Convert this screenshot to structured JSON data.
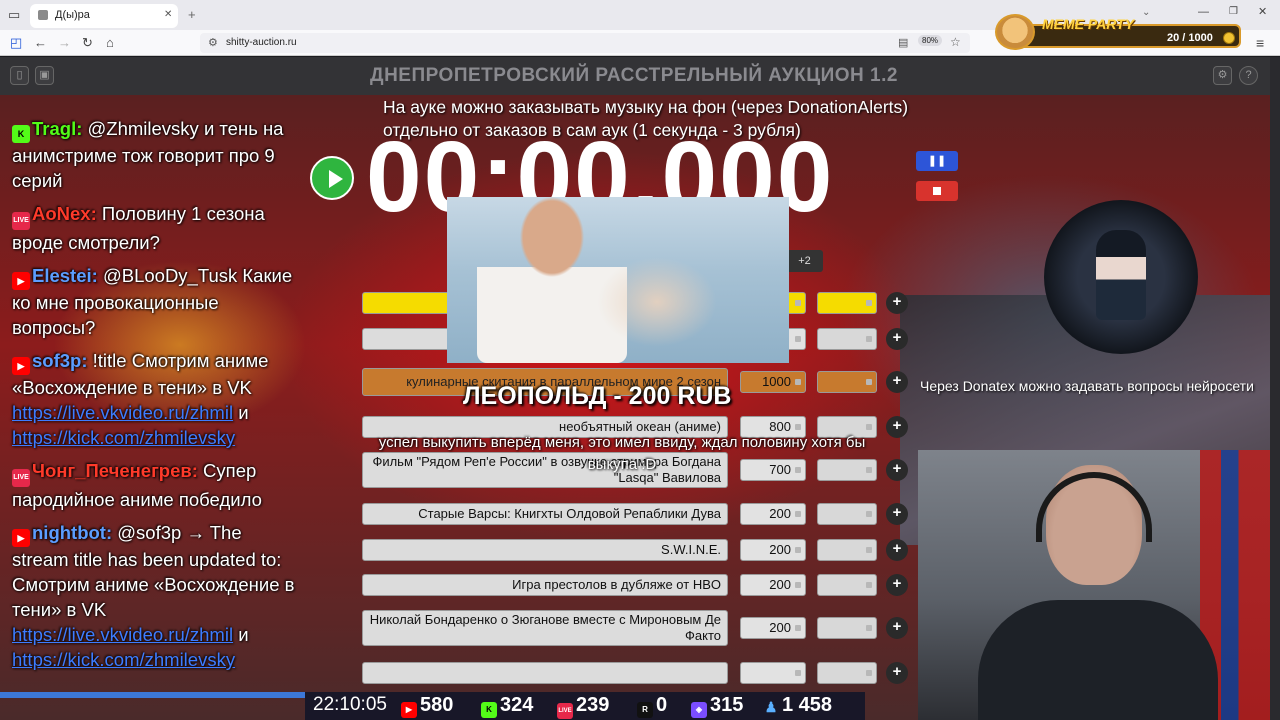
{
  "browser": {
    "tab_title": "Д(ы)ра",
    "url": "shitty-auction.ru",
    "zoom": "80%",
    "new_tab": "+",
    "tab_close": "✕"
  },
  "meme_party": {
    "title": "MEME PARTY",
    "score": "20 / 1000"
  },
  "app": {
    "title": "ДНЕПРОПЕТРОВСКИЙ РАССТРЕЛЬНЫЙ АУКЦИОН 1.2"
  },
  "chat": [
    {
      "badge": "kick",
      "user": "Tragl:",
      "user_color": "green",
      "text": " @Zhmilevsky и тень на анимстриме тож говорит про 9 серий"
    },
    {
      "badge": "live",
      "user": "AoNex:",
      "user_color": "red",
      "text": " Половину 1 сезона вроде смотрели?"
    },
    {
      "badge": "yt",
      "user": "Elestei:",
      "user_color": "blue",
      "text": " @BLooDy_Tusk Какие ко мне провокационные вопросы?"
    },
    {
      "badge": "yt",
      "user": "sof3p:",
      "user_color": "blue",
      "text": " !title Смотрим аниме «Восхождение в тени» в VK ",
      "link1": "https://live.vkvideo.ru/zhmil",
      "mid": " и ",
      "link2": "https://kick.com/zhmilevsky"
    },
    {
      "badge": "live",
      "user": "Чонг_Печенегрев:",
      "user_color": "red",
      "text": " Супер пародийное аниме победило"
    },
    {
      "badge": "yt",
      "user": "nightbot:",
      "user_color": "blue",
      "text": " @sof3p → The stream title has been updated to: Смотрим аниме «Восхождение в тени» в VK ",
      "link1": "https://live.vkvideo.ru/zhmil",
      "mid": " и ",
      "link2": "https://kick.com/zhmilevsky"
    }
  ],
  "notice": "На ауке можно заказывать музыку на фон (через DonationAlerts) отдельно от заказов в сам аук (1 секунда - 3 рубля)",
  "timer": "00:00.000",
  "pause_label": "❚❚",
  "plus_badge": "+2",
  "donation": {
    "title": "ЛЕОПОЛЬД - 200 RUB",
    "message": "успел выкупить вперёд меня, это имел ввиду, ждал половину хотя бы выкупа :D"
  },
  "lots": [
    {
      "name": "",
      "amount": "",
      "color": "yellow"
    },
    {
      "name": "",
      "amount": "",
      "color": "grey"
    },
    {
      "name": "кулинарные скитания в параллельном мире 2 сезон",
      "amount": "1000",
      "color": "orange"
    },
    {
      "name": "необъятный океан (аниме)",
      "amount": "800",
      "color": "grey"
    },
    {
      "name": "Фильм \"Рядом Реп'е России\" в озвучке стримера Богдана \"Lasqa\" Вавилова",
      "amount": "700",
      "color": "grey"
    },
    {
      "name": "Старые Варсы: Книгхты Олдовой Репаблики Дува",
      "amount": "200",
      "color": "grey"
    },
    {
      "name": "S.W.I.N.E.",
      "amount": "200",
      "color": "grey"
    },
    {
      "name": "Игра престолов в дубляже от HBO",
      "amount": "200",
      "color": "grey"
    },
    {
      "name": "Николай Бондаренко о Зюганове вместе с Мироновым Де Факто",
      "amount": "200",
      "color": "grey"
    },
    {
      "name": "",
      "amount": "",
      "color": "grey"
    }
  ],
  "plus": "+",
  "donatex_text": "Через Donatex можно задавать вопросы нейросети",
  "stats": {
    "time": "22:10:05",
    "youtube": "580",
    "kick": "324",
    "live": "239",
    "r": "0",
    "twitch": "315",
    "total": "1 458"
  },
  "colors": {
    "accent_green": "#2fb53f",
    "pause_blue": "#2d55d8",
    "stop_red": "#d8332d",
    "kick_green": "#53fc18"
  }
}
